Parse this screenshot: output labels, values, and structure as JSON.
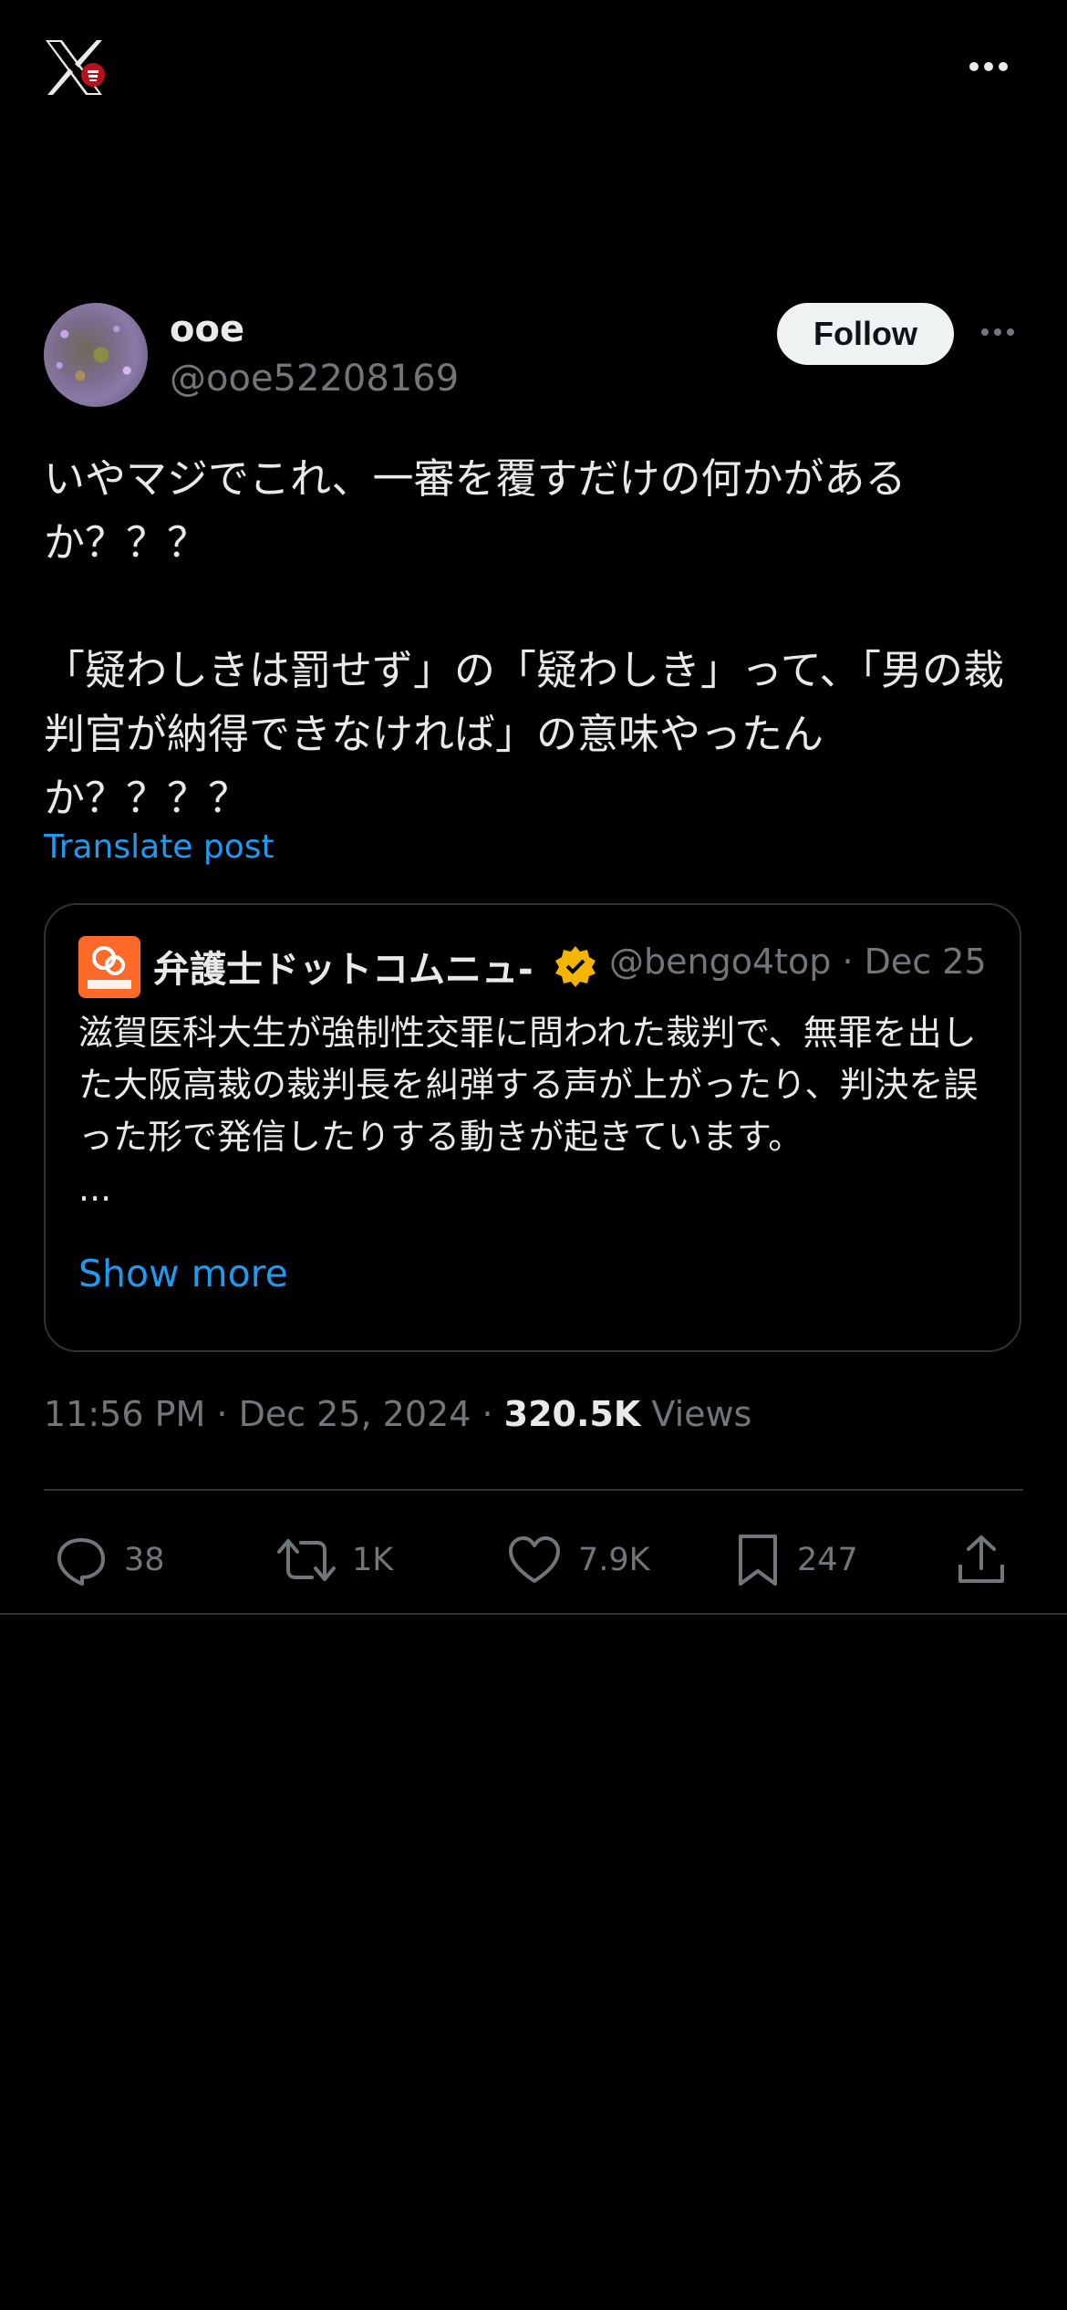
{
  "topbar": {
    "logo_icon": "x-logo-icon",
    "more_icon": "more-horizontal-icon"
  },
  "tweet": {
    "author_name": "ooe",
    "author_handle": "@ooe52208169",
    "follow_label": "Follow",
    "text": "いやマジでこれ、一審を覆すだけの何かがあるか？？？\n\n「疑わしきは罰せず」の「疑わしき」って、「男の裁判官が納得できなければ」の意味やったんか？？？？",
    "translate_label": "Translate post",
    "quote": {
      "author_name": "弁護士ドットコムニュ-",
      "author_handle": "@bengo4top",
      "date": "Dec 25",
      "text": "滋賀医科大生が強制性交罪に問われた裁判で、無罪を出した大阪高裁の裁判長を糾弾する声が上がったり、判決を誤った形で発信したりする動きが起きています。\n...",
      "show_more_label": "Show more",
      "verified_badge_color": "#f4b400"
    },
    "time": "11:56 PM",
    "date": "Dec 25, 2024",
    "views_count": "320.5K",
    "views_label": "Views",
    "actions": {
      "replies": "38",
      "reposts": "1K",
      "likes": "7.9K",
      "bookmarks": "247"
    }
  },
  "colors": {
    "background": "#000000",
    "text": "#e7e9ea",
    "muted": "#71767b",
    "link": "#1d9bf0",
    "border": "#2f3336"
  }
}
